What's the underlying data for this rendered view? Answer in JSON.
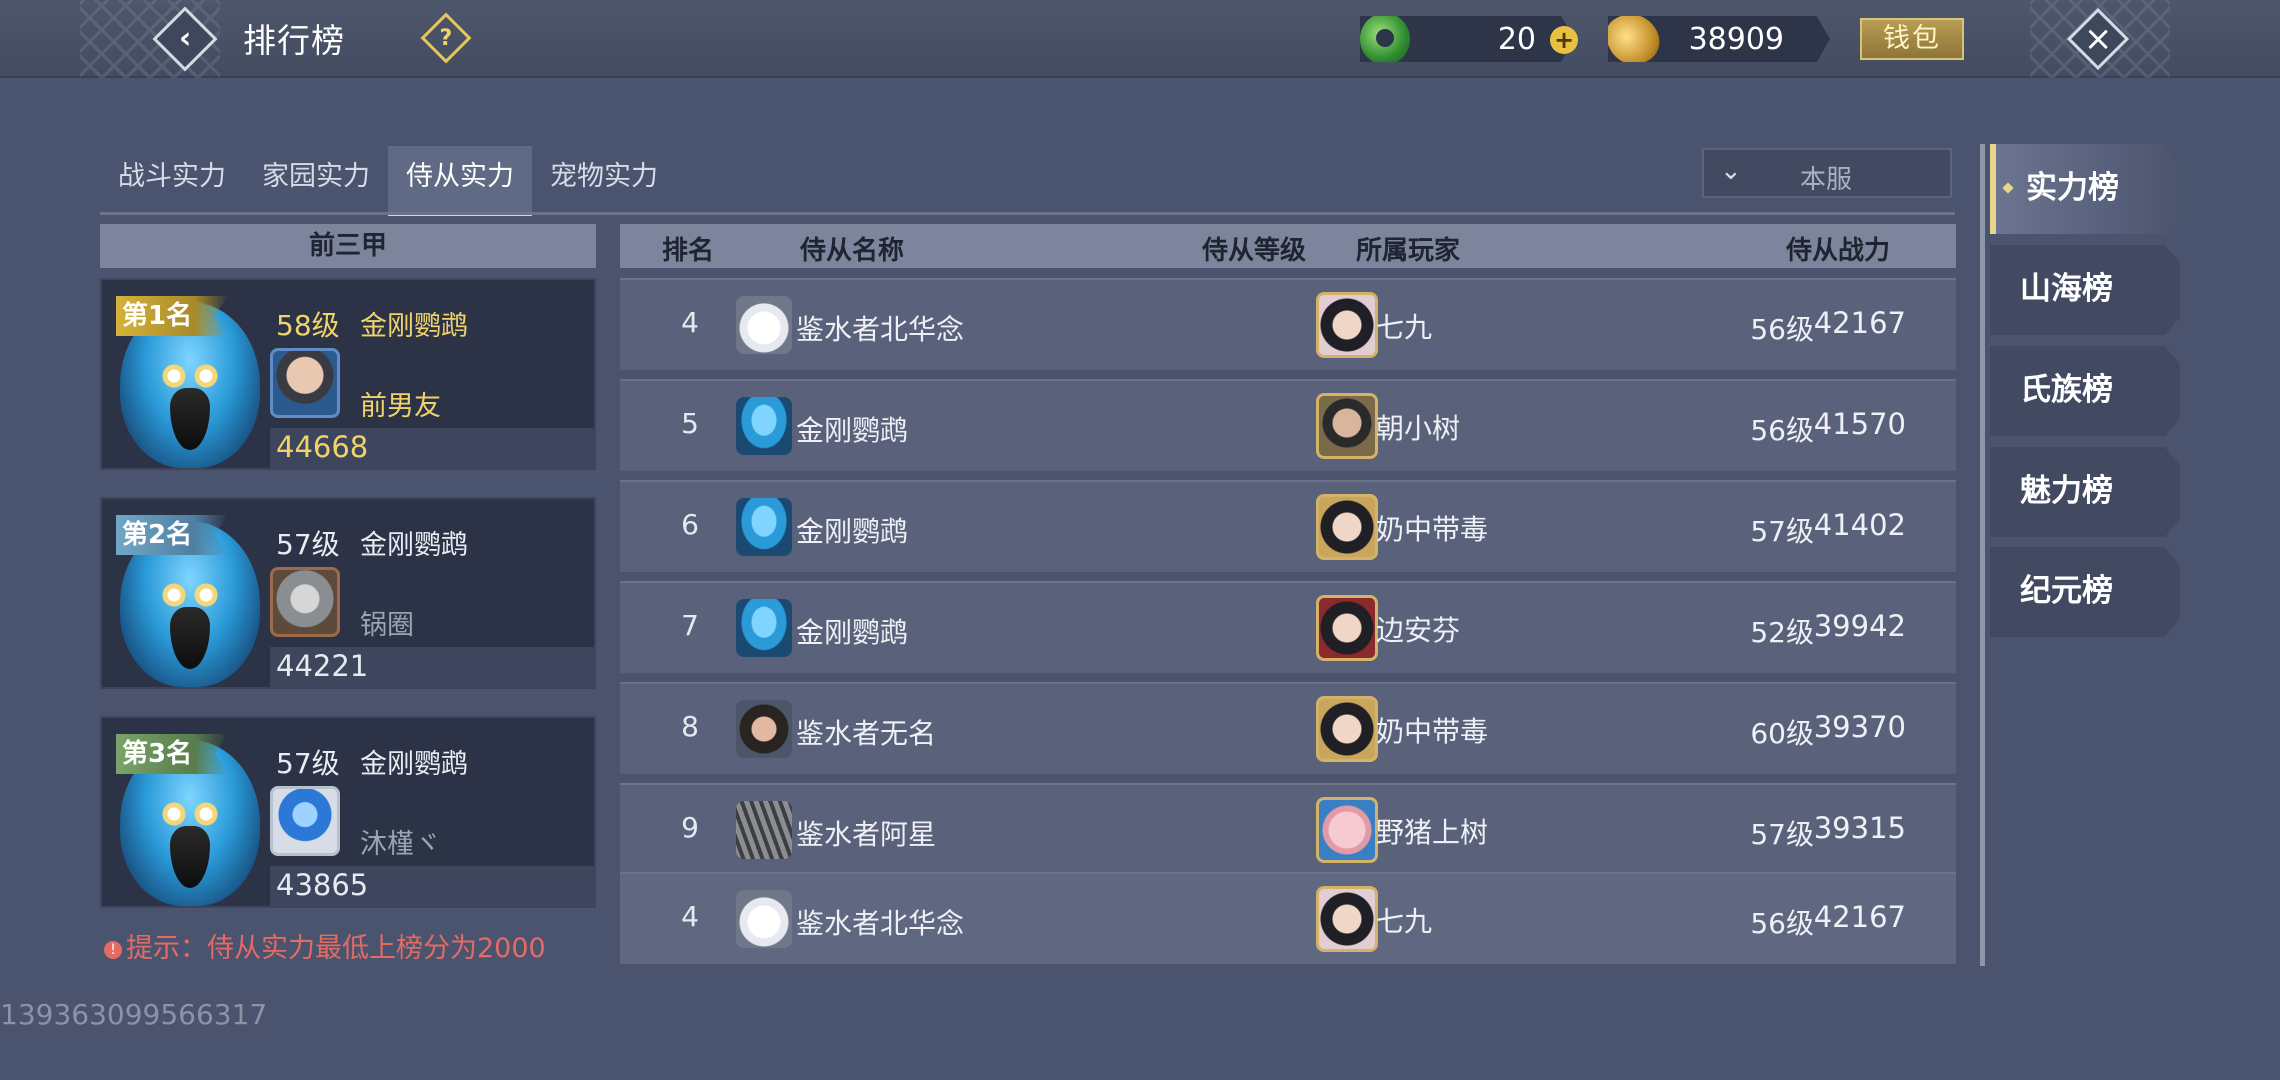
{
  "header": {
    "title": "排行榜",
    "help_icon": "question-icon",
    "jade_amount": "20",
    "gold_amount": "38909",
    "wallet_label": "钱包"
  },
  "tabs": [
    {
      "label": "战斗实力",
      "active": false
    },
    {
      "label": "家园实力",
      "active": false
    },
    {
      "label": "侍从实力",
      "active": true
    },
    {
      "label": "宠物实力",
      "active": false
    }
  ],
  "server_select": {
    "value": "本服"
  },
  "top_three": {
    "header": "前三甲",
    "entries": [
      {
        "badge": "第1名",
        "level": "58级",
        "pet_name": "金刚鹦鹉",
        "player": "前男友",
        "power": "44668"
      },
      {
        "badge": "第2名",
        "level": "57级",
        "pet_name": "金刚鹦鹉",
        "player": "锅圈",
        "power": "44221"
      },
      {
        "badge": "第3名",
        "level": "57级",
        "pet_name": "金刚鹦鹉",
        "player": "沐槿ヾ",
        "power": "43865"
      }
    ],
    "hint": "提示：侍从实力最低上榜分为2000"
  },
  "table": {
    "headers": {
      "rank": "排名",
      "name": "侍从名称",
      "level": "侍从等级",
      "player": "所属玩家",
      "power": "侍从战力"
    },
    "rows": [
      {
        "rank": "4",
        "name": "鉴水者北华念",
        "level": "56级",
        "player": "七九",
        "power": "42167"
      },
      {
        "rank": "5",
        "name": "金刚鹦鹉",
        "level": "56级",
        "player": "朝小树",
        "power": "41570"
      },
      {
        "rank": "6",
        "name": "金刚鹦鹉",
        "level": "57级",
        "player": "奶中带毒",
        "power": "41402"
      },
      {
        "rank": "7",
        "name": "金刚鹦鹉",
        "level": "52级",
        "player": "边安芬",
        "power": "39942"
      },
      {
        "rank": "8",
        "name": "鉴水者无名",
        "level": "60级",
        "player": "奶中带毒",
        "power": "39370"
      },
      {
        "rank": "9",
        "name": "鉴水者阿星",
        "level": "57级",
        "player": "野猪上树",
        "power": "39315"
      }
    ],
    "my_row": {
      "rank": "4",
      "name": "鉴水者北华念",
      "level": "56级",
      "player": "七九",
      "power": "42167"
    }
  },
  "side_menu": [
    {
      "label": "实力榜",
      "active": true
    },
    {
      "label": "山海榜",
      "active": false
    },
    {
      "label": "氏族榜",
      "active": false
    },
    {
      "label": "魅力榜",
      "active": false
    },
    {
      "label": "纪元榜",
      "active": false
    }
  ],
  "uid": "139363099566317",
  "colors": {
    "gold": "#f0d36a",
    "hint": "#e36b63",
    "tab_active_underline": "#e9d58c"
  }
}
